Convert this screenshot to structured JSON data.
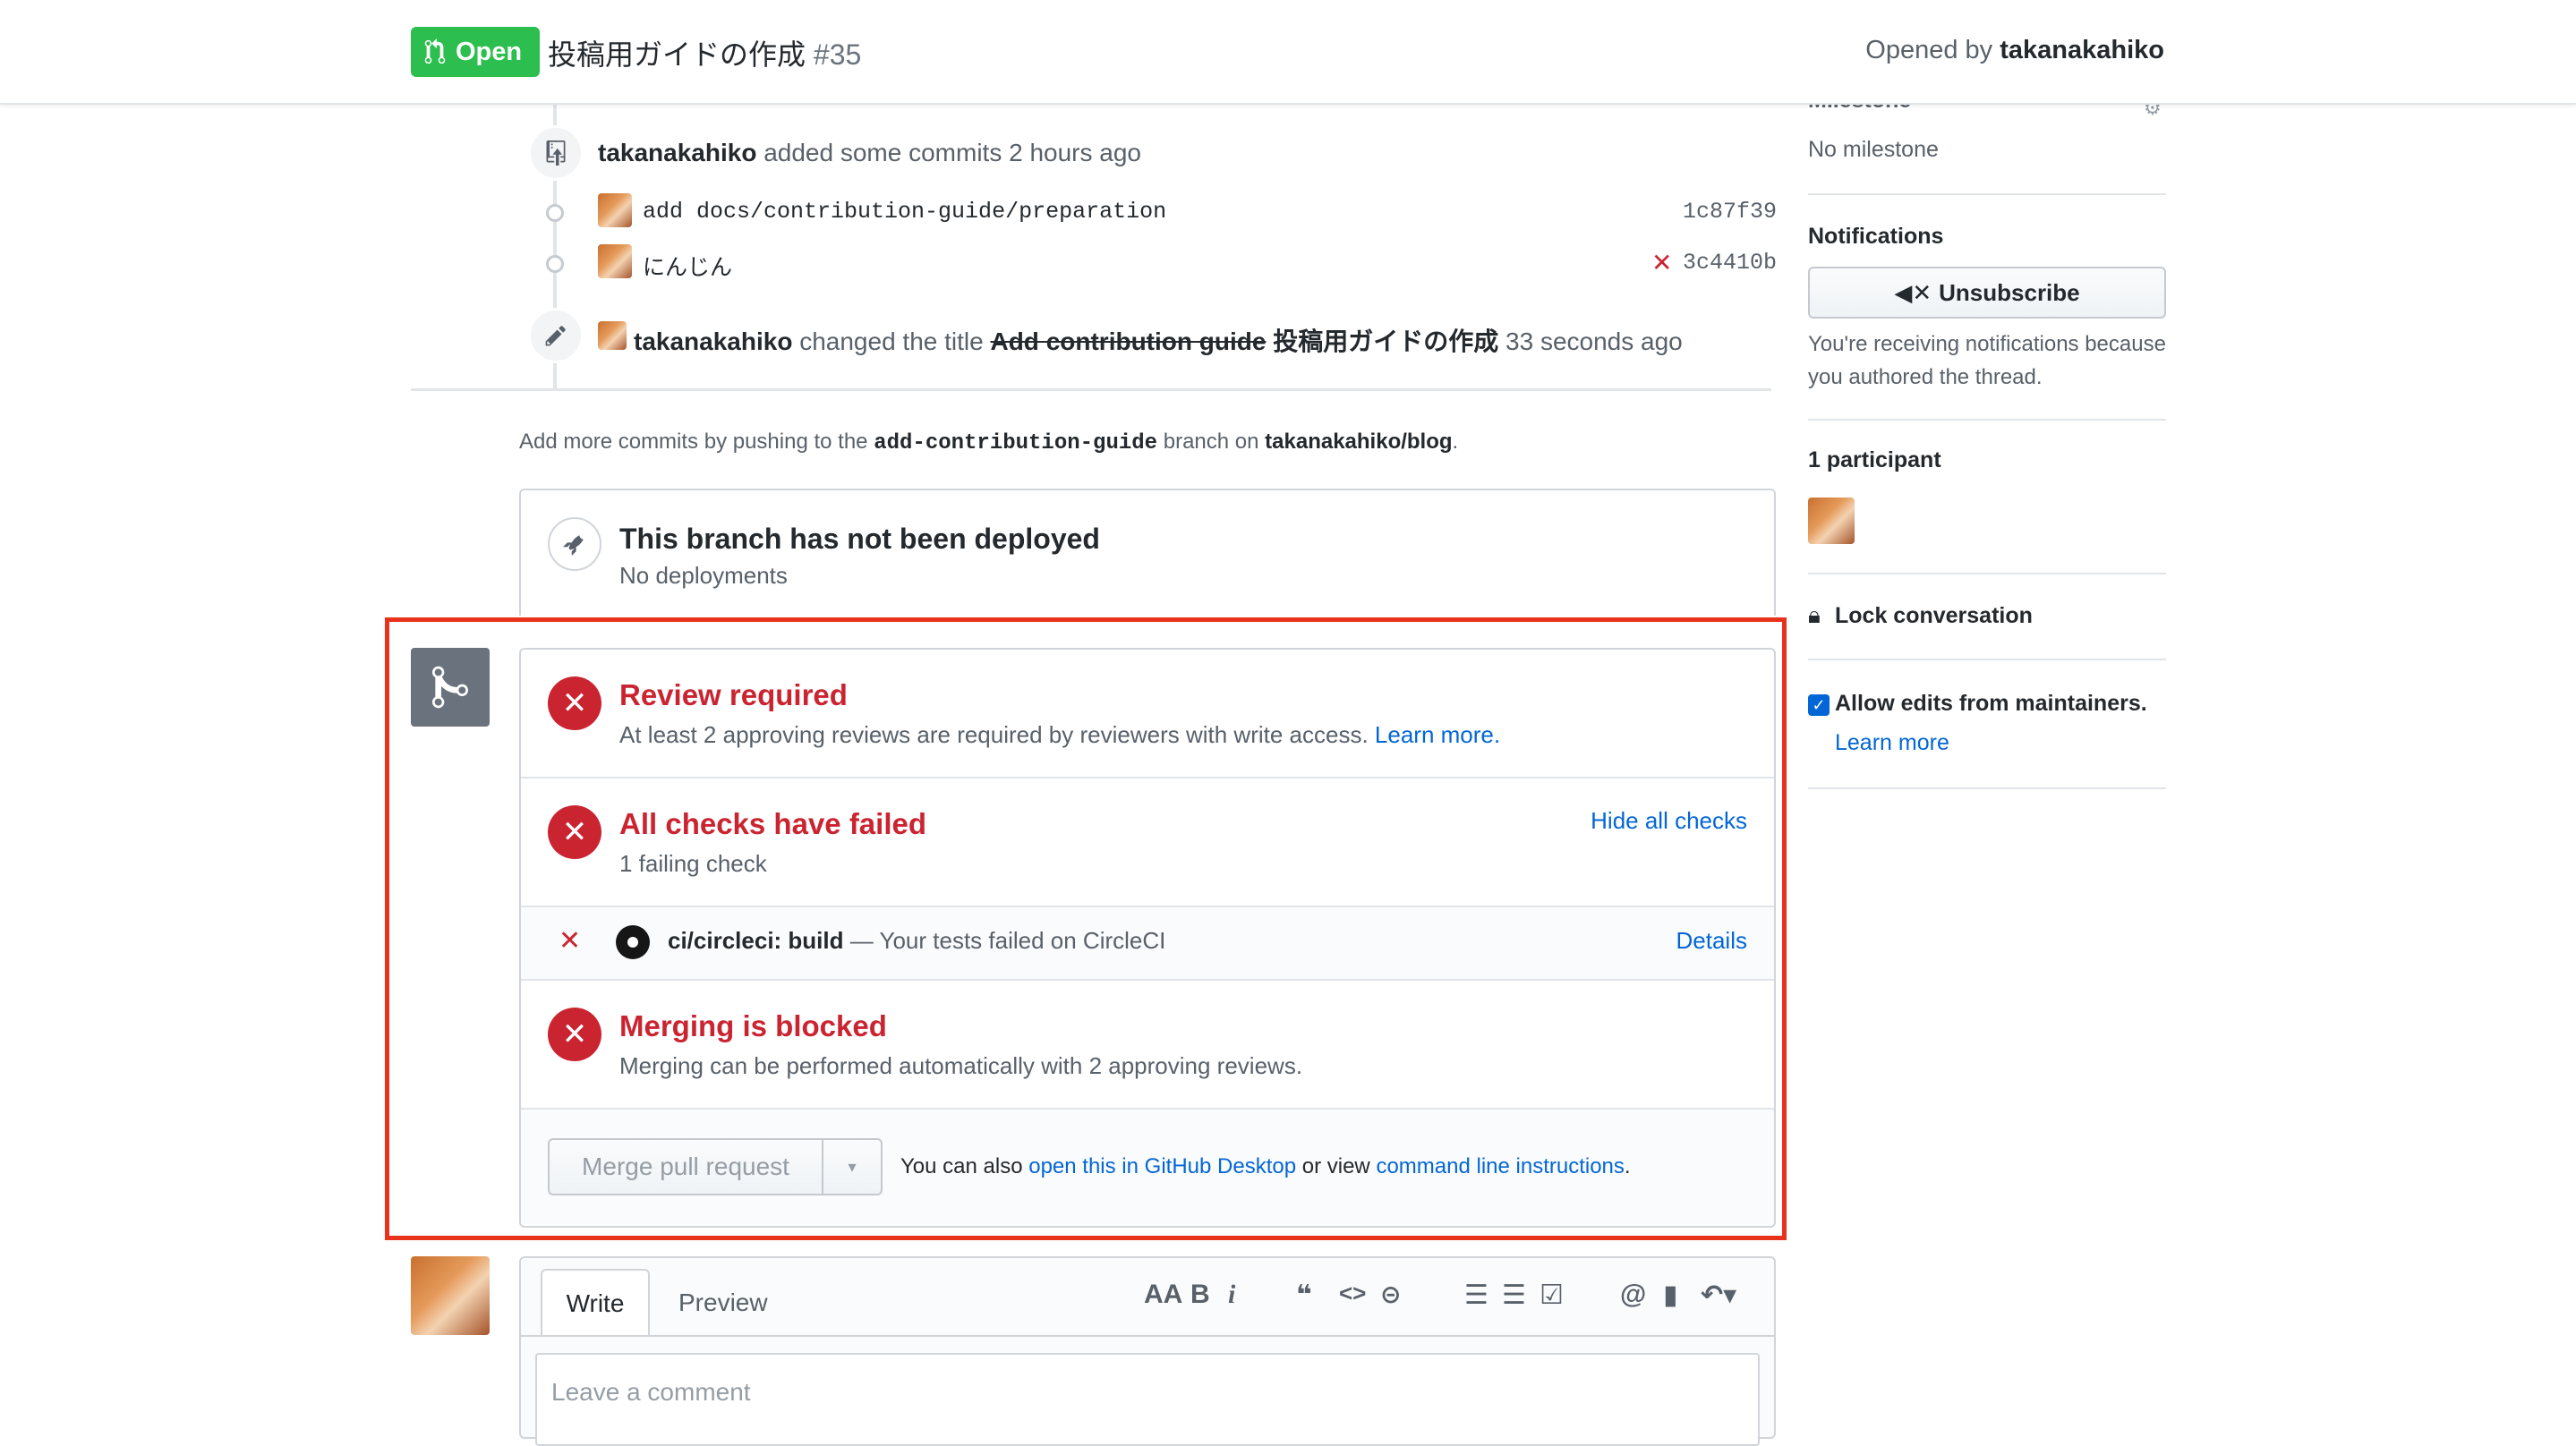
{
  "header": {
    "status": "Open",
    "title": "投稿用ガイドの作成",
    "number": "#35",
    "opened_by_prefix": "Opened by",
    "opened_by_user": "takanakahiko"
  },
  "timeline": {
    "commits_event": {
      "user": "takanakahiko",
      "text": "added some commits 2 hours ago"
    },
    "commits": [
      {
        "message": "add docs/contribution-guide/preparation",
        "sha": "1c87f39",
        "status": "none"
      },
      {
        "message": "にんじん",
        "sha": "3c4410b",
        "status": "failed"
      }
    ],
    "title_event": {
      "user": "takanakahiko",
      "text": "changed the title",
      "old_title": "Add contribution guide",
      "new_title": "投稿用ガイドの作成",
      "time": "33 seconds ago"
    }
  },
  "push_hint": {
    "prefix": "Add more commits by pushing to the",
    "branch": "add-contribution-guide",
    "middle": "branch on",
    "repo": "takanakahiko/blog",
    "suffix": "."
  },
  "deploy": {
    "title": "This branch has not been deployed",
    "subtitle": "No deployments"
  },
  "merge_box": {
    "review": {
      "title": "Review required",
      "text": "At least 2 approving reviews are required by reviewers with write access.",
      "link": "Learn more."
    },
    "checks": {
      "title": "All checks have failed",
      "subtitle": "1 failing check",
      "toggle": "Hide all checks"
    },
    "check_item": {
      "name": "ci/circleci: build",
      "desc": "— Your tests failed on CircleCI",
      "details": "Details"
    },
    "blocked": {
      "title": "Merging is blocked",
      "text": "Merging can be performed automatically with 2 approving reviews."
    },
    "merge_button": "Merge pull request",
    "alt_prefix": "You can also",
    "alt_link1": "open this in GitHub Desktop",
    "alt_middle": "or view",
    "alt_link2": "command line instructions",
    "alt_suffix": "."
  },
  "comment": {
    "tab_write": "Write",
    "tab_preview": "Preview",
    "placeholder": "Leave a comment"
  },
  "sidebar": {
    "milestone_label": "Milestone",
    "milestone_value": "No milestone",
    "notifications_label": "Notifications",
    "unsubscribe": "Unsubscribe",
    "notif_reason": "You're receiving notifications because you authored the thread.",
    "participants_label": "1 participant",
    "lock": "Lock conversation",
    "allow_edits": "Allow edits from maintainers.",
    "learn_more": "Learn more"
  },
  "colors": {
    "green": "#2cbe4e",
    "red": "#cb2431",
    "link": "#0366d6",
    "highlight": "#e8321c"
  }
}
